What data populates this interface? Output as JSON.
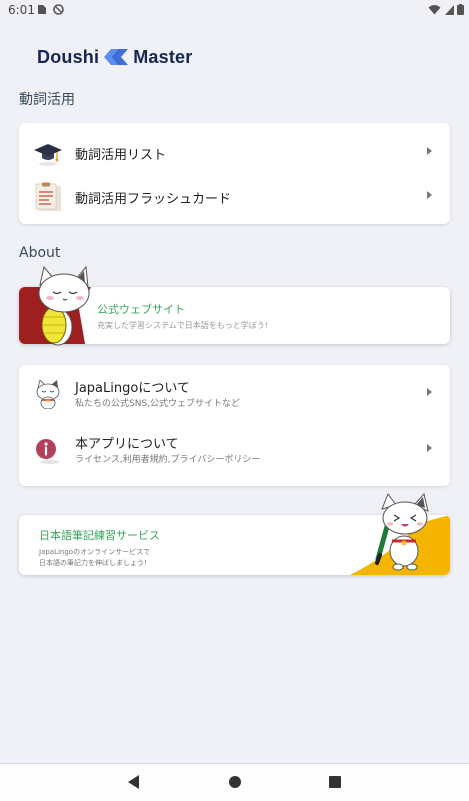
{
  "status_bar": {
    "time": "6:01"
  },
  "logo": {
    "left_word": "Doushi",
    "right_word": "Master"
  },
  "sections": {
    "conjugation_title": "動詞活用",
    "about_title": "About"
  },
  "conjugation_card": {
    "items": [
      {
        "label": "動詞活用リスト",
        "icon": "graduation-cap-icon"
      },
      {
        "label": "動詞活用フラッシュカード",
        "icon": "flashcard-clipboard-icon"
      }
    ]
  },
  "website_banner": {
    "title": "公式ウェブサイト",
    "subtitle": "充実した学習システムで日本語をもっと学ぼう!"
  },
  "about_card": {
    "items": [
      {
        "title": "JapaLingoについて",
        "subtitle": "私たちの公式SNS,公式ウェブサイトなど",
        "icon": "cat-mascot-icon"
      },
      {
        "title": "本アプリについて",
        "subtitle": "ライセンス,利用者規約,プライバシーポリシー",
        "icon": "info-icon"
      }
    ]
  },
  "writing_banner": {
    "title": "日本語筆記練習サービス",
    "line1": "JapaLingoのオンラインサービスで",
    "line2": "日本語の筆記力を伸ばしましょう!"
  },
  "colors": {
    "accent_green": "#3aa55a",
    "banner_red": "#9e1f1f",
    "banner_yellow": "#f5b400",
    "logo_navy": "#172553"
  }
}
